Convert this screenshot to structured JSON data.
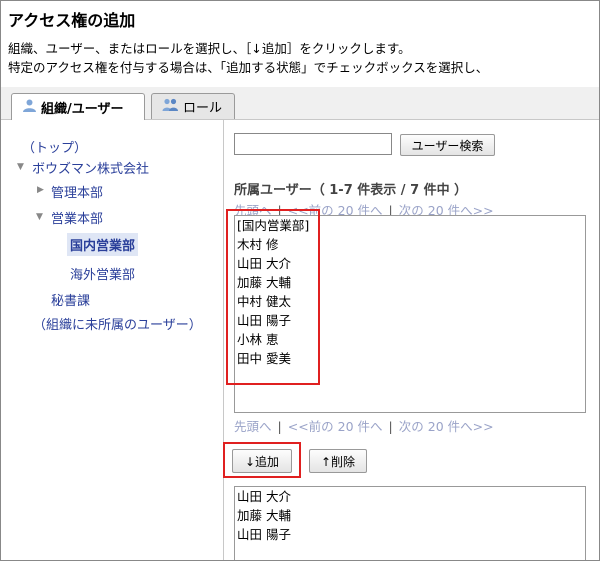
{
  "page": {
    "title": "アクセス権の追加",
    "desc1": "組織、ユーザー、またはロールを選択し、［↓追加］をクリックします。",
    "desc2": "特定のアクセス権を付与する場合は、「追加する状態」でチェックボックスを選択し、"
  },
  "tabs": {
    "org_user": "組織/ユーザー",
    "role": "ロール"
  },
  "tree": {
    "top": "（トップ）",
    "company": "ボウズマン株式会社",
    "management": "管理本部",
    "sales": "営業本部",
    "domestic": "国内営業部",
    "overseas": "海外営業部",
    "secretary": "秘書課",
    "unassigned": "（組織に未所属のユーザー）"
  },
  "search": {
    "input_value": "",
    "button": "ユーザー検索"
  },
  "members": {
    "heading": "所属ユーザー（ 1-7 件表示 / 7 件中 ）",
    "pager_first": "先頭へ",
    "pager_prev": "<<前の 20 件へ",
    "pager_next": "次の 20 件へ>>",
    "pager_sep": "|",
    "items": [
      "[国内営業部]",
      "木村 修",
      "山田 大介",
      "加藤 大輔",
      "中村 健太",
      "山田 陽子",
      "小林 恵",
      "田中 愛美"
    ]
  },
  "actions": {
    "add": "↓追加",
    "remove": "↑削除"
  },
  "selected": {
    "items": [
      "山田 大介",
      "加藤 大輔",
      "山田 陽子"
    ]
  },
  "icons": {
    "org_user_tab": "users-icon",
    "role_tab": "role-users-icon",
    "tree_expanded": "triangle-down-icon",
    "tree_collapsed": "triangle-right-icon"
  },
  "colors": {
    "link": "#2a3f9a",
    "highlight": "#e02020",
    "selected_bg": "#dfe6f5"
  }
}
